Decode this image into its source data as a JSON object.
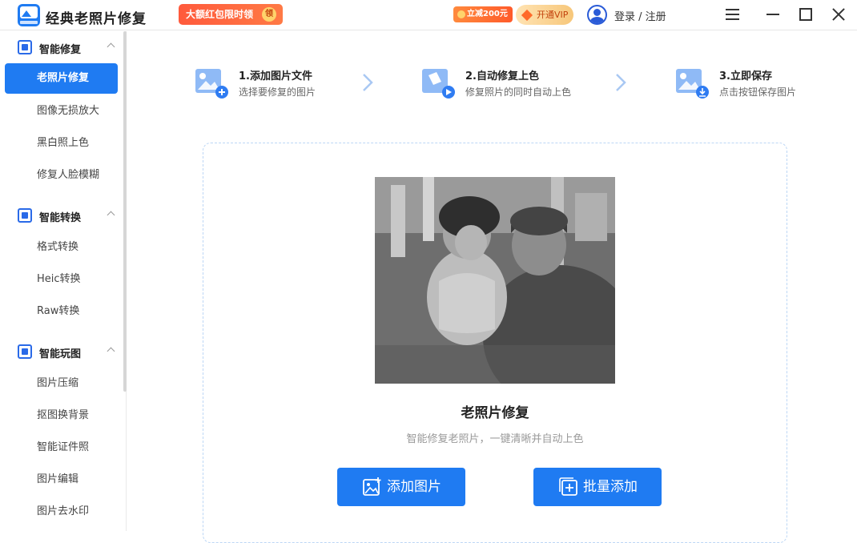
{
  "titlebar": {
    "app_title": "经典老照片修复",
    "promo": "大额红包限时领",
    "promo_coin": "领",
    "discount_badge": "立减200元",
    "vip_button": "开通VIP",
    "login": "登录 / 注册"
  },
  "sidebar": {
    "groups": [
      {
        "label": "智能修复",
        "items": [
          "老照片修复",
          "图像无损放大",
          "黑白照上色",
          "修复人脸模糊"
        ]
      },
      {
        "label": "智能转换",
        "items": [
          "格式转换",
          "Heic转换",
          "Raw转换"
        ]
      },
      {
        "label": "智能玩图",
        "items": [
          "图片压缩",
          "抠图换背景",
          "智能证件照",
          "图片编辑",
          "图片去水印"
        ]
      }
    ],
    "active_item": "老照片修复"
  },
  "steps": [
    {
      "title": "1.添加图片文件",
      "desc": "选择要修复的图片"
    },
    {
      "title": "2.自动修复上色",
      "desc": "修复照片的同时自动上色"
    },
    {
      "title": "3.立即保存",
      "desc": "点击按钮保存图片"
    }
  ],
  "main": {
    "card_title": "老照片修复",
    "card_subtitle": "智能修复老照片，一键清晰并自动上色",
    "add_image_button": "添加图片",
    "batch_add_button": "批量添加"
  },
  "colors": {
    "accent": "#1f7bf2",
    "promo": "#ff5a3c",
    "vip": "#f7c77a"
  }
}
